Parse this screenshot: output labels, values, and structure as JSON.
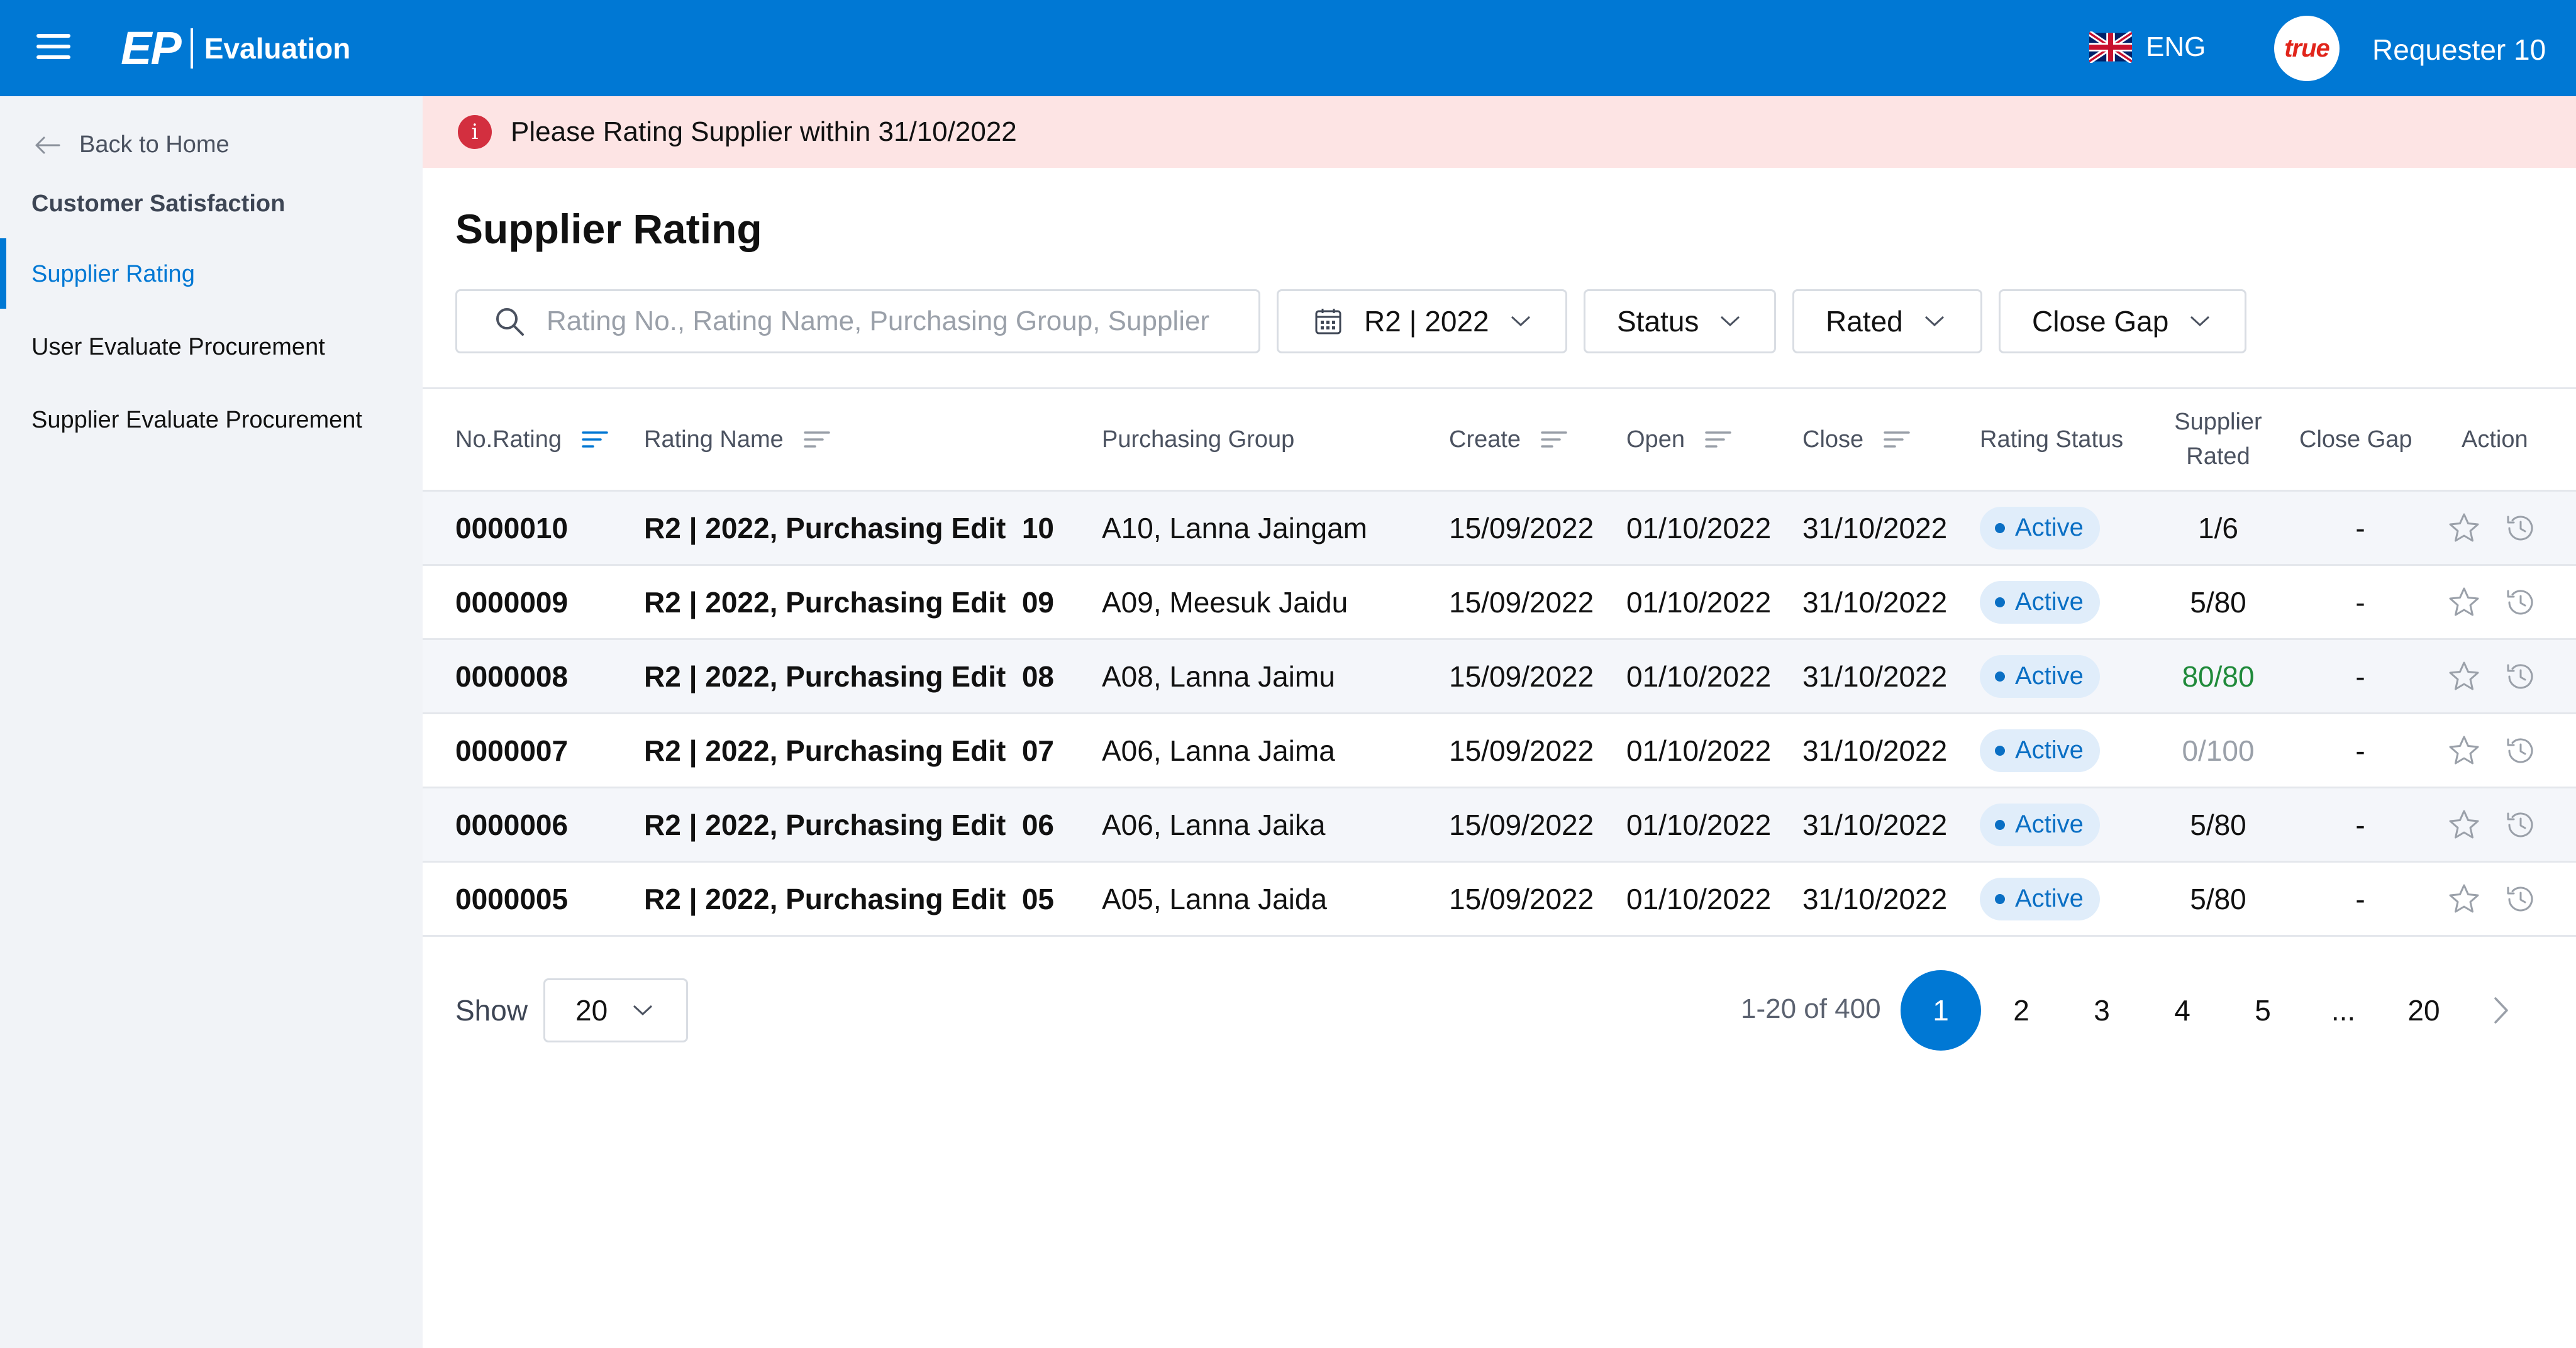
{
  "header": {
    "logo_mark": "EP",
    "logo_text": "Evaluation",
    "language": "ENG",
    "avatar_text": "true",
    "user_name": "Requester 10"
  },
  "sidebar": {
    "back_label": "Back to Home",
    "section": "Customer Satisfaction",
    "items": [
      {
        "label": "Supplier Rating",
        "active": true
      },
      {
        "label": "User Evaluate Procurement",
        "active": false
      },
      {
        "label": "Supplier Evaluate Procurement",
        "active": false
      }
    ]
  },
  "alert": {
    "icon": "info-icon",
    "glyph": "i",
    "text": "Please Rating Supplier within 31/10/2022"
  },
  "page_title": "Supplier Rating",
  "filters": {
    "search_placeholder": "Rating No., Rating Name, Purchasing Group, Supplier",
    "period": "R2 | 2022",
    "status": "Status",
    "rated": "Rated",
    "close_gap": "Close Gap"
  },
  "table": {
    "columns": {
      "no_rating": "No.Rating",
      "rating_name": "Rating Name",
      "purchasing_group": "Purchasing Group",
      "create": "Create",
      "open": "Open",
      "close": "Close",
      "rating_status": "Rating Status",
      "supplier_rated_1": "Supplier",
      "supplier_rated_2": "Rated",
      "close_gap": "Close Gap",
      "action": "Action"
    },
    "rows": [
      {
        "no": "0000010",
        "name": "R2 | 2022, Purchasing Edit  10",
        "group": "A10, Lanna Jaingam",
        "create": "15/09/2022",
        "open": "01/10/2022",
        "close": "31/10/2022",
        "status": "Active",
        "rated": "1/6",
        "rated_tone": "normal",
        "gap": "-"
      },
      {
        "no": "0000009",
        "name": "R2 | 2022, Purchasing Edit  09",
        "group": "A09, Meesuk Jaidu",
        "create": "15/09/2022",
        "open": "01/10/2022",
        "close": "31/10/2022",
        "status": "Active",
        "rated": "5/80",
        "rated_tone": "normal",
        "gap": "-"
      },
      {
        "no": "0000008",
        "name": "R2 | 2022, Purchasing Edit  08",
        "group": "A08, Lanna Jaimu",
        "create": "15/09/2022",
        "open": "01/10/2022",
        "close": "31/10/2022",
        "status": "Active",
        "rated": "80/80",
        "rated_tone": "complete",
        "gap": "-"
      },
      {
        "no": "0000007",
        "name": "R2 | 2022, Purchasing Edit  07",
        "group": "A06, Lanna Jaima",
        "create": "15/09/2022",
        "open": "01/10/2022",
        "close": "31/10/2022",
        "status": "Active",
        "rated": "0/100",
        "rated_tone": "muted",
        "gap": "-"
      },
      {
        "no": "0000006",
        "name": "R2 | 2022, Purchasing Edit  06",
        "group": "A06, Lanna Jaika",
        "create": "15/09/2022",
        "open": "01/10/2022",
        "close": "31/10/2022",
        "status": "Active",
        "rated": "5/80",
        "rated_tone": "normal",
        "gap": "-"
      },
      {
        "no": "0000005",
        "name": "R2 | 2022, Purchasing Edit  05",
        "group": "A05, Lanna Jaida",
        "create": "15/09/2022",
        "open": "01/10/2022",
        "close": "31/10/2022",
        "status": "Active",
        "rated": "5/80",
        "rated_tone": "normal",
        "gap": "-"
      }
    ]
  },
  "pagination": {
    "show_label": "Show",
    "page_size": "20",
    "range": "1-20 of 400",
    "pages": [
      "1",
      "2",
      "3",
      "4",
      "5",
      "...",
      "20"
    ],
    "current": "1"
  },
  "colors": {
    "brand": "#0078d4",
    "alert_bg": "#fde4e4",
    "complete": "#1f8a3a"
  }
}
